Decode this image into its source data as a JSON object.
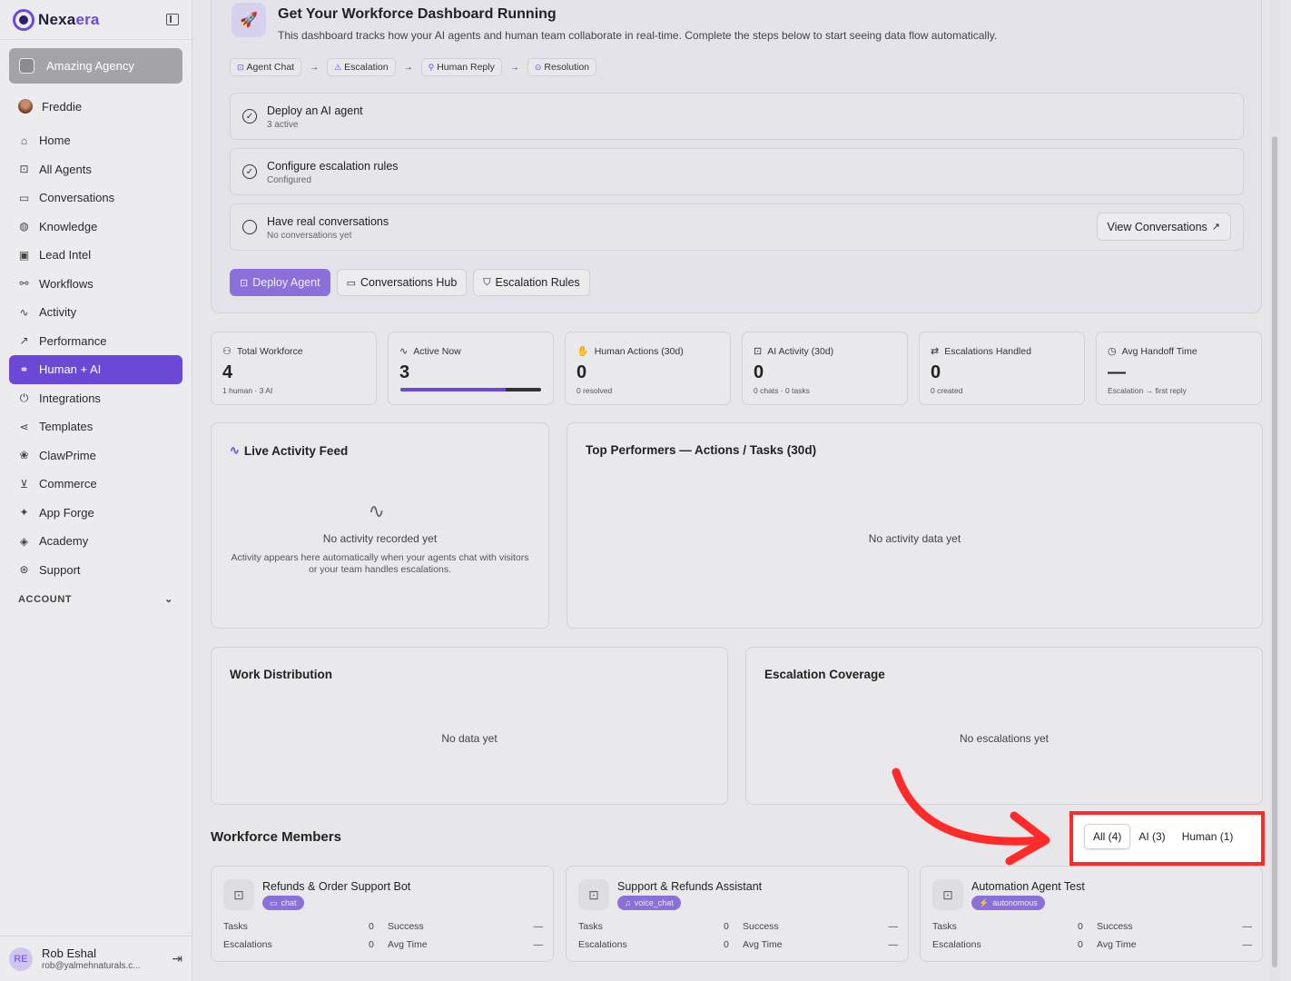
{
  "brand": {
    "name_a": "Nexa",
    "name_b": "era"
  },
  "sidebar": {
    "agency": "Amazing Agency",
    "user": "Freddie",
    "items": [
      {
        "label": "Home",
        "icon": "home-icon",
        "glyph": "⌂"
      },
      {
        "label": "All Agents",
        "icon": "robot-icon",
        "glyph": "⊡"
      },
      {
        "label": "Conversations",
        "icon": "chat-icon",
        "glyph": "▭"
      },
      {
        "label": "Knowledge",
        "icon": "brain-icon",
        "glyph": "◍"
      },
      {
        "label": "Lead Intel",
        "icon": "contact-icon",
        "glyph": "▣"
      },
      {
        "label": "Workflows",
        "icon": "workflow-icon",
        "glyph": "⚯"
      },
      {
        "label": "Activity",
        "icon": "activity-icon",
        "glyph": "∿"
      },
      {
        "label": "Performance",
        "icon": "trend-icon",
        "glyph": "↗"
      },
      {
        "label": "Human + AI",
        "icon": "network-icon",
        "glyph": "⚭",
        "active": true
      },
      {
        "label": "Integrations",
        "icon": "plug-icon",
        "glyph": "⏻"
      },
      {
        "label": "Templates",
        "icon": "share-icon",
        "glyph": "⋖"
      },
      {
        "label": "ClawPrime",
        "icon": "paw-icon",
        "glyph": "❀"
      },
      {
        "label": "Commerce",
        "icon": "cart-icon",
        "glyph": "⊻"
      },
      {
        "label": "App Forge",
        "icon": "sparkle-icon",
        "glyph": "✦"
      },
      {
        "label": "Academy",
        "icon": "graduation-icon",
        "glyph": "◈"
      },
      {
        "label": "Support",
        "icon": "lifebuoy-icon",
        "glyph": "⊛"
      }
    ],
    "account_label": "ACCOUNT",
    "bottom_user": {
      "initials": "RE",
      "name": "Rob Eshal",
      "email": "rob@yalmehnaturals.c..."
    }
  },
  "onboarding": {
    "title": "Get Your Workforce Dashboard Running",
    "description": "This dashboard tracks how your AI agents and human team collaborate in real-time. Complete the steps below to start seeing data flow automatically.",
    "flow": [
      "Agent Chat",
      "Escalation",
      "Human Reply",
      "Resolution"
    ],
    "steps": [
      {
        "title": "Deploy an AI agent",
        "sub": "3 active",
        "done": true
      },
      {
        "title": "Configure escalation rules",
        "sub": "Configured",
        "done": true
      },
      {
        "title": "Have real conversations",
        "sub": "No conversations yet",
        "done": false,
        "action": "View Conversations"
      }
    ],
    "buttons": [
      "Deploy Agent",
      "Conversations Hub",
      "Escalation Rules"
    ]
  },
  "stats": [
    {
      "label": "Total Workforce",
      "value": "4",
      "sub": "1 human · 3 AI",
      "icon": "users-icon"
    },
    {
      "label": "Active Now",
      "value": "3",
      "progress": 0.75,
      "icon": "activity-icon"
    },
    {
      "label": "Human Actions (30d)",
      "value": "0",
      "sub": "0 resolved",
      "icon": "hand-icon"
    },
    {
      "label": "AI Activity (30d)",
      "value": "0",
      "sub": "0 chats · 0 tasks",
      "icon": "robot-icon"
    },
    {
      "label": "Escalations Handled",
      "value": "0",
      "sub": "0 created",
      "icon": "swap-icon"
    },
    {
      "label": "Avg Handoff Time",
      "value": "—",
      "sub": "Escalation → first reply",
      "icon": "clock-icon"
    }
  ],
  "panels": {
    "live_feed": {
      "title": "Live Activity Feed",
      "empty": "No activity recorded yet",
      "empty_sub": "Activity appears here automatically when your agents chat with visitors or your team handles escalations."
    },
    "top_performers": {
      "title": "Top Performers — Actions / Tasks (30d)",
      "empty": "No activity data yet"
    },
    "work_distribution": {
      "title": "Work Distribution",
      "empty": "No data yet"
    },
    "escalation_coverage": {
      "title": "Escalation Coverage",
      "empty": "No escalations yet"
    }
  },
  "workforce": {
    "title": "Workforce Members",
    "filters": [
      "All (4)",
      "AI (3)",
      "Human (1)"
    ],
    "members": [
      {
        "name": "Refunds & Order Support Bot",
        "tag": "chat",
        "tasks_label": "Tasks",
        "tasks": "0",
        "success_label": "Success",
        "success": "—",
        "esc_label": "Escalations",
        "esc": "0",
        "avg_label": "Avg Time",
        "avg": "—"
      },
      {
        "name": "Support & Refunds Assistant",
        "tag": "voice_chat",
        "tasks_label": "Tasks",
        "tasks": "0",
        "success_label": "Success",
        "success": "—",
        "esc_label": "Escalations",
        "esc": "0",
        "avg_label": "Avg Time",
        "avg": "—"
      },
      {
        "name": "Automation Agent Test",
        "tag": "autonomous",
        "tasks_label": "Tasks",
        "tasks": "0",
        "success_label": "Success",
        "success": "—",
        "esc_label": "Escalations",
        "esc": "0",
        "avg_label": "Avg Time",
        "avg": "—"
      }
    ]
  },
  "colors": {
    "accent": "#6b49d6",
    "annotation": "#ff2b2b"
  }
}
